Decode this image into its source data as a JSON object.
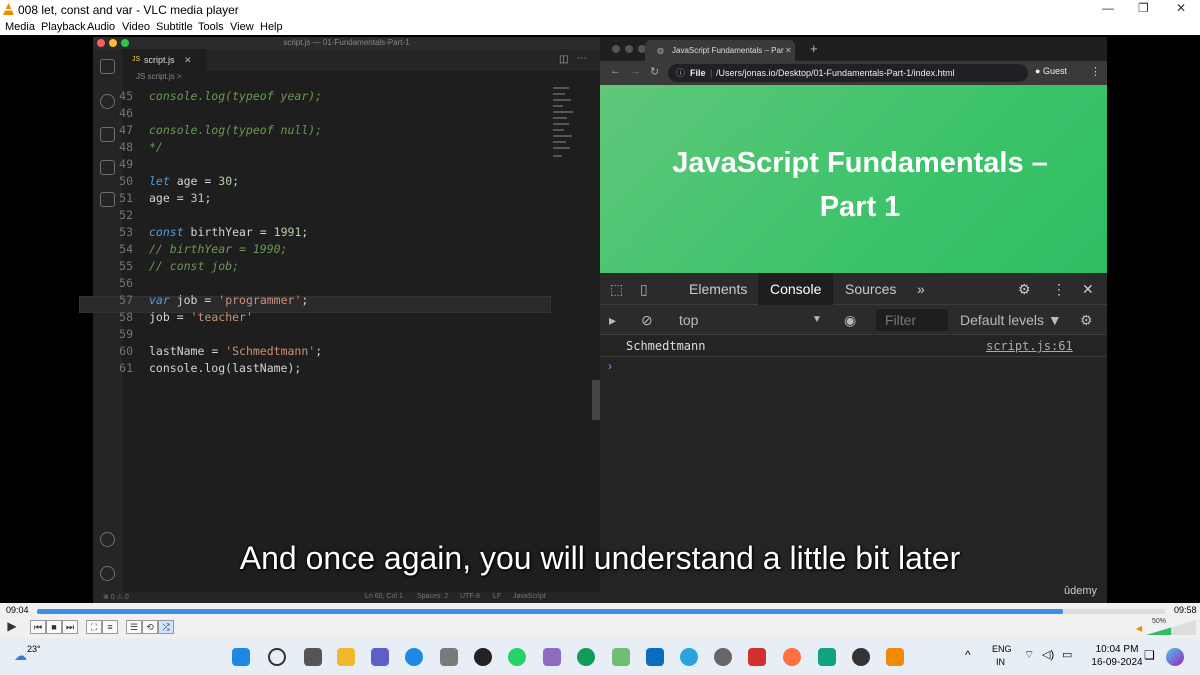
{
  "window": {
    "title": "008 let, const and var - VLC media player",
    "menu": [
      "Media",
      "Playback",
      "Audio",
      "Video",
      "Subtitle",
      "Tools",
      "View",
      "Help"
    ]
  },
  "editor": {
    "title": "script.js — 01-Fundamentals-Part-1",
    "tab_label": "script.js",
    "breadcrumb": "JS script.js >",
    "lines": [
      {
        "n": "45",
        "html": "<span class='cm'>console.log(typeof year);</span>"
      },
      {
        "n": "46",
        "html": ""
      },
      {
        "n": "47",
        "html": "<span class='cm'>console.log(typeof null);</span>"
      },
      {
        "n": "48",
        "html": "<span class='cm'>*/</span>"
      },
      {
        "n": "49",
        "html": ""
      },
      {
        "n": "50",
        "html": "<span class='kw'>let</span> age <span class='op'>=</span> <span class='num'>30</span>;"
      },
      {
        "n": "51",
        "html": "age <span class='op'>=</span> <span class='num'>31</span>;"
      },
      {
        "n": "52",
        "html": ""
      },
      {
        "n": "53",
        "html": "<span class='kw'>const</span> birthYear <span class='op'>=</span> <span class='num'>1991</span>;"
      },
      {
        "n": "54",
        "html": "<span class='cm'>// birthYear = 1990;</span>"
      },
      {
        "n": "55",
        "html": "<span class='cm'>// const job;</span>"
      },
      {
        "n": "56",
        "html": ""
      },
      {
        "n": "57",
        "html": "<span class='kw'>var</span> job <span class='op'>=</span> <span class='str'>'programmer'</span>;"
      },
      {
        "n": "58",
        "html": "job <span class='op'>=</span> <span class='str'>'teacher'</span>"
      },
      {
        "n": "59",
        "html": ""
      },
      {
        "n": "60",
        "html": "lastName <span class='op'>=</span> <span class='str'>'Schmedtmann'</span>;"
      },
      {
        "n": "61",
        "html": "console.log(lastName);"
      }
    ],
    "status": {
      "errors": "⊗ 0 ⚠ 0",
      "position": "Ln 60, Col 1",
      "spaces": "Spaces: 2",
      "encoding": "UTF-8",
      "eol": "LF",
      "language": "JavaScript"
    }
  },
  "browser": {
    "tab_title": "JavaScript Fundamentals – Par",
    "address_scheme": "File",
    "address": "/Users/jonas.io/Desktop/01-Fundamentals-Part-1/index.html",
    "profile": "Guest",
    "page_heading": "JavaScript Fundamentals – Part 1",
    "devtools": {
      "tabs": [
        "Elements",
        "Console",
        "Sources"
      ],
      "active_tab": "Console",
      "context": "top",
      "filter_placeholder": "Filter",
      "levels": "Default levels ▼",
      "log_text": "Schmedtmann",
      "log_source": "script.js:61"
    }
  },
  "subtitle": "And once again, you will understand a little bit later",
  "watermark": "ûdemy",
  "player": {
    "elapsed": "09:04",
    "total": "09:58",
    "progress": 0.91,
    "volume": "50%"
  },
  "taskbar": {
    "weather": "23°",
    "lang": "ENG",
    "region": "IN",
    "time": "10:04 PM",
    "date": "16-09-2024"
  },
  "colors": {
    "accent": "#3f8fe0",
    "page_green": "#3cc36a"
  }
}
